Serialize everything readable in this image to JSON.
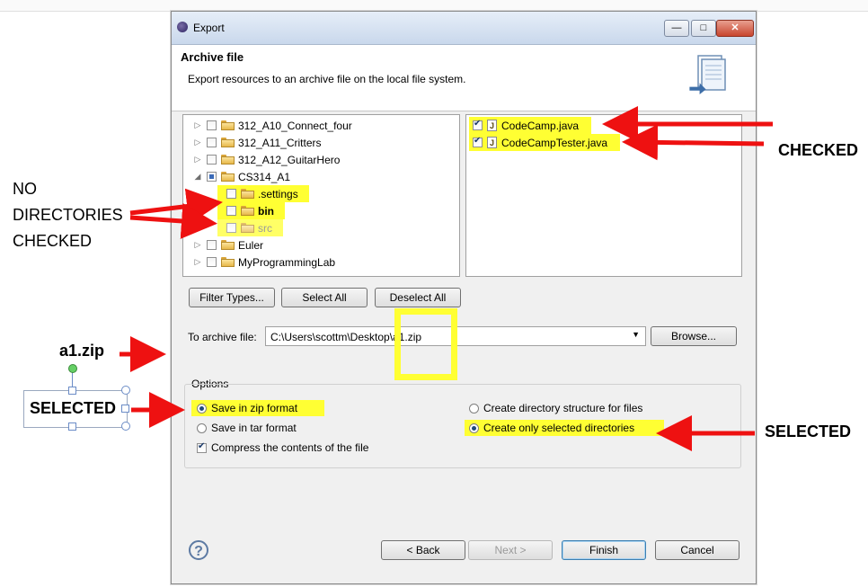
{
  "window": {
    "title": "Export"
  },
  "header": {
    "title": "Archive file",
    "description": "Export resources to an archive file on the local file system."
  },
  "tree": {
    "items": [
      {
        "label": "312_A10_Connect_four",
        "checked": false
      },
      {
        "label": "312_A11_Critters",
        "checked": false
      },
      {
        "label": "312_A12_GuitarHero",
        "checked": false
      },
      {
        "label": "CS314_A1",
        "checked": "partial"
      },
      {
        "label": ".settings",
        "checked": false
      },
      {
        "label": "bin",
        "checked": false
      },
      {
        "label": "src",
        "checked": false
      },
      {
        "label": "Euler",
        "checked": false
      },
      {
        "label": "MyProgrammingLab",
        "checked": false
      }
    ]
  },
  "files": {
    "items": [
      {
        "label": "CodeCamp.java",
        "checked": true,
        "icon": "J"
      },
      {
        "label": "CodeCampTester.java",
        "checked": true,
        "icon": "J"
      }
    ]
  },
  "buttons": {
    "filter_types": "Filter Types...",
    "select_all": "Select All",
    "deselect_all": "Deselect All",
    "browse": "Browse...",
    "back": "< Back",
    "next": "Next >",
    "finish": "Finish",
    "cancel": "Cancel",
    "help": "?"
  },
  "archive": {
    "label": "To archive file:",
    "value": "C:\\Users\\scottm\\Desktop\\a1.zip"
  },
  "options": {
    "title": "Options",
    "zip": "Save in zip format",
    "tar": "Save in tar format",
    "compress": "Compress the contents of the file",
    "dir_structure": "Create directory structure for files",
    "selected_dirs": "Create only selected directories"
  },
  "annotations": {
    "checked": "CHECKED",
    "no_dirs_line1": "NO",
    "no_dirs_line2": "DIRECTORIES",
    "no_dirs_line3": "CHECKED",
    "a1zip": "a1.zip",
    "selected_left": "SELECTED",
    "selected_right": "SELECTED"
  },
  "colors": {
    "highlight": "#ffff33",
    "arrow": "#ee1111",
    "accent": "#3c7fb1"
  }
}
